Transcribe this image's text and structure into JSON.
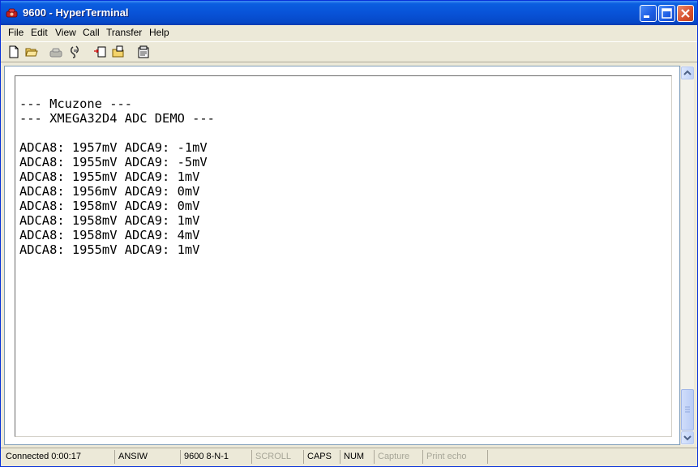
{
  "window": {
    "title": "9600 - HyperTerminal"
  },
  "menu": [
    "File",
    "Edit",
    "View",
    "Call",
    "Transfer",
    "Help"
  ],
  "toolbar": {
    "icons": [
      "new-icon",
      "open-icon",
      "dial-icon",
      "disconnect-icon",
      "send-icon",
      "receive-icon",
      "properties-icon"
    ]
  },
  "terminal": {
    "lines": [
      "--- Mcuzone ---",
      "--- XMEGA32D4 ADC DEMO ---",
      "",
      "ADCA8: 1957mV ADCA9: -1mV",
      "ADCA8: 1955mV ADCA9: -5mV",
      "ADCA8: 1955mV ADCA9: 1mV",
      "ADCA8: 1956mV ADCA9: 0mV",
      "ADCA8: 1958mV ADCA9: 0mV",
      "ADCA8: 1958mV ADCA9: 1mV",
      "ADCA8: 1958mV ADCA9: 4mV",
      "ADCA8: 1955mV ADCA9: 1mV"
    ]
  },
  "status": {
    "connected": "Connected 0:00:17",
    "emulation": "ANSIW",
    "settings": "9600 8-N-1",
    "scroll": "SCROLL",
    "caps": "CAPS",
    "num": "NUM",
    "capture": "Capture",
    "print_echo": "Print echo"
  },
  "colors": {
    "titlebar": "#0853d8",
    "terminal_bg": "#ffffff",
    "terminal_text": "#000000"
  }
}
